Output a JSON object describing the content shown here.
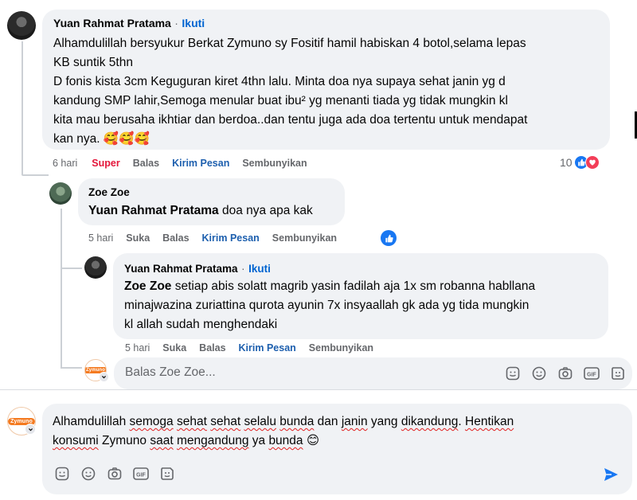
{
  "comment1": {
    "author": "Yuan Rahmat Pratama",
    "separator": "·",
    "follow_label": "Ikuti",
    "lines": [
      "Alhamdulillah bersyukur Berkat Zymuno sy Fositif hamil habiskan 4 botol,selama lepas",
      "KB suntik 5thn",
      "D fonis kista 3cm Keguguran kiret 4thn lalu. Minta doa nya supaya sehat janin yg d",
      "kandung SMP lahir,Semoga menular buat ibu² yg menanti tiada yg tidak mungkin kl",
      "kita mau berusaha ikhtiar dan berdoa..dan tentu juga ada doa tertentu untuk mendapat",
      "kan nya. 🥰🥰🥰"
    ],
    "time": "6 hari",
    "reaction_label": "Super",
    "reply_label": "Balas",
    "message_label": "Kirim Pesan",
    "hide_label": "Sembunyikan",
    "reaction_count": "10"
  },
  "comment2": {
    "author": "Zoe Zoe",
    "mention": "Yuan Rahmat Pratama",
    "text": " doa nya apa kak",
    "time": "5 hari",
    "like_label": "Suka",
    "reply_label": "Balas",
    "message_label": "Kirim Pesan",
    "hide_label": "Sembunyikan"
  },
  "comment3": {
    "author": "Yuan Rahmat Pratama",
    "separator": "·",
    "follow_label": "Ikuti",
    "mention": "Zoe Zoe",
    "line1": " setiap abis solatt magrib yasin fadilah aja 1x sm robanna habllana",
    "line2": "minajwazina zuriattina qurota ayunin 7x insyaallah gk ada yg tida mungkin",
    "line3": "kl allah sudah menghendaki",
    "time": "5 hari",
    "like_label": "Suka",
    "reply_label": "Balas",
    "message_label": "Kirim Pesan",
    "hide_label": "Sembunyikan"
  },
  "reply_input": {
    "brand": "Zymuno",
    "placeholder": "Balas Zoe Zoe..."
  },
  "composer": {
    "brand": "Zymuno",
    "line1_words": [
      "Alhamdulillah",
      " ",
      "semoga",
      " ",
      "sehat",
      " ",
      "sehat",
      " ",
      "selalu",
      " ",
      "bunda",
      " dan ",
      "janin",
      " yang ",
      "dikandung",
      ". ",
      "Hentikan"
    ],
    "line1_underlined": [
      false,
      false,
      true,
      false,
      true,
      false,
      true,
      false,
      true,
      false,
      true,
      false,
      true,
      false,
      true,
      false,
      true
    ],
    "line2_words": [
      "konsumi",
      " Zymuno ",
      "saat",
      " ",
      "mengandung",
      " ya ",
      "bunda",
      " 😊"
    ],
    "line2_underlined": [
      true,
      false,
      true,
      false,
      true,
      false,
      true,
      false
    ]
  },
  "icons": {
    "sticker": "sticker-icon",
    "emoji": "emoji-icon",
    "camera": "camera-icon",
    "gif": "gif-icon",
    "avatar_sticker": "avatar-sticker-icon",
    "send": "send-icon",
    "gif_label": "GIF"
  },
  "colors": {
    "link_blue": "#1d5fae",
    "follow_blue": "#0064d1",
    "super_red": "#e4163a",
    "brand_orange": "#f47a20",
    "send_blue": "#1877f2"
  }
}
